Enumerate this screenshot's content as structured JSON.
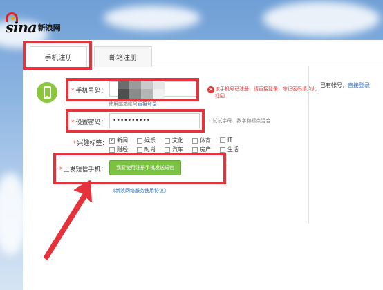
{
  "logo": {
    "wordmark": "sina",
    "chinese": "新浪网"
  },
  "tabs": [
    {
      "label": "手机注册",
      "active": true
    },
    {
      "label": "邮箱注册",
      "active": false
    }
  ],
  "form": {
    "phone": {
      "label": "手机号码：",
      "value": "",
      "hint_prefix": "使用邮箱帐号",
      "hint_link": "直接登录",
      "error": "该手机号已注册，请直接登录，忘记密码请点此找回"
    },
    "password": {
      "label": "设置密码：",
      "value": "••••••••••",
      "hint": "试试字母、数字和标点混合"
    },
    "interests": {
      "label": "兴趣标签：",
      "options": [
        {
          "label": "新闻",
          "checked": true
        },
        {
          "label": "娱乐",
          "checked": false
        },
        {
          "label": "文化",
          "checked": false
        },
        {
          "label": "体育",
          "checked": false
        },
        {
          "label": "IT",
          "checked": false
        },
        {
          "label": "财经",
          "checked": false
        },
        {
          "label": "时尚",
          "checked": false
        },
        {
          "label": "汽车",
          "checked": false
        },
        {
          "label": "房产",
          "checked": false
        },
        {
          "label": "生活",
          "checked": false
        }
      ]
    },
    "sms": {
      "label": "上发短信手机：",
      "button": "我要使用注册手机发送短信"
    },
    "agreement": "《新浪网络服务使用协议》"
  },
  "side": {
    "prefix": "已有帐号，",
    "link": "直接登录"
  },
  "mosaic_colors": [
    "#6d6d6d",
    "#9a9a9a",
    "#c9c9c9",
    "#e6e6e6",
    "#4e4e4e",
    "#8a8a8a",
    "#b4b4b4",
    "#f0f0f0"
  ],
  "colors": {
    "highlight": "#e5323b",
    "accent_green": "#7bc142",
    "link": "#2a6ebb",
    "error": "#e33333"
  }
}
